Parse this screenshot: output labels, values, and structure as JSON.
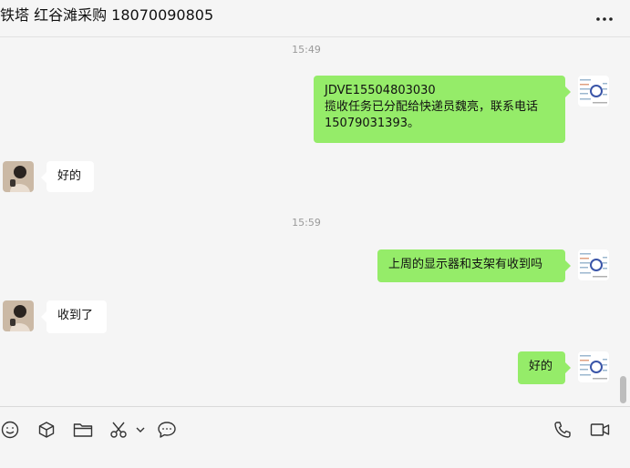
{
  "header": {
    "title": "铁塔 红谷滩采购 18070090805",
    "more_icon": "more-dots-icon"
  },
  "messages": [
    {
      "type": "time",
      "text": "15:49"
    },
    {
      "type": "out",
      "lines": [
        "JDVE15504803030",
        "揽收任务已分配给快递员魏亮，联系电话",
        "15079031393。"
      ]
    },
    {
      "type": "in",
      "text": "好的"
    },
    {
      "type": "time",
      "text": "15:59"
    },
    {
      "type": "out",
      "text": "上周的显示器和支架有收到吗"
    },
    {
      "type": "in",
      "text": "收到了"
    },
    {
      "type": "out",
      "text": "好的"
    }
  ],
  "colors": {
    "outgoing_bubble": "#95ec69",
    "incoming_bubble": "#ffffff",
    "background": "#f5f5f5"
  },
  "toolbar": {
    "left_icons": [
      "emoji-icon",
      "sticker-box-icon",
      "folder-icon",
      "scissors-icon",
      "chevron-down-icon",
      "chat-bubble-icon"
    ],
    "right_icons": [
      "phone-icon",
      "video-icon"
    ]
  }
}
